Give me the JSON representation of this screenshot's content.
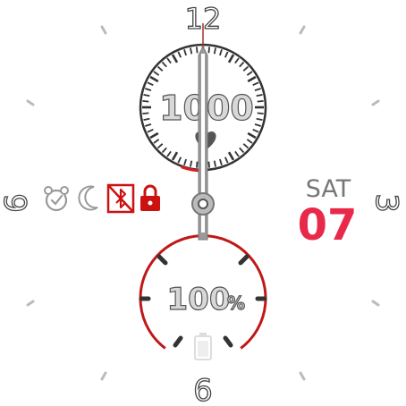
{
  "watch_face": {
    "hour_numerals": {
      "twelve": "12",
      "three": "3",
      "six": "6",
      "nine": "9"
    },
    "steps": {
      "value": "1000"
    },
    "battery": {
      "percent_text": "100",
      "percent_symbol": "%",
      "level_fraction": 1.0
    },
    "date": {
      "day": "SAT",
      "date": "07"
    },
    "status_icons": [
      "alarm-icon",
      "moon-icon",
      "bluetooth-icon",
      "lock-icon"
    ],
    "colors": {
      "accent_red": "#d62020",
      "date_red": "#e8294a",
      "dark": "#333333",
      "hand": "#9a9a9a"
    }
  }
}
